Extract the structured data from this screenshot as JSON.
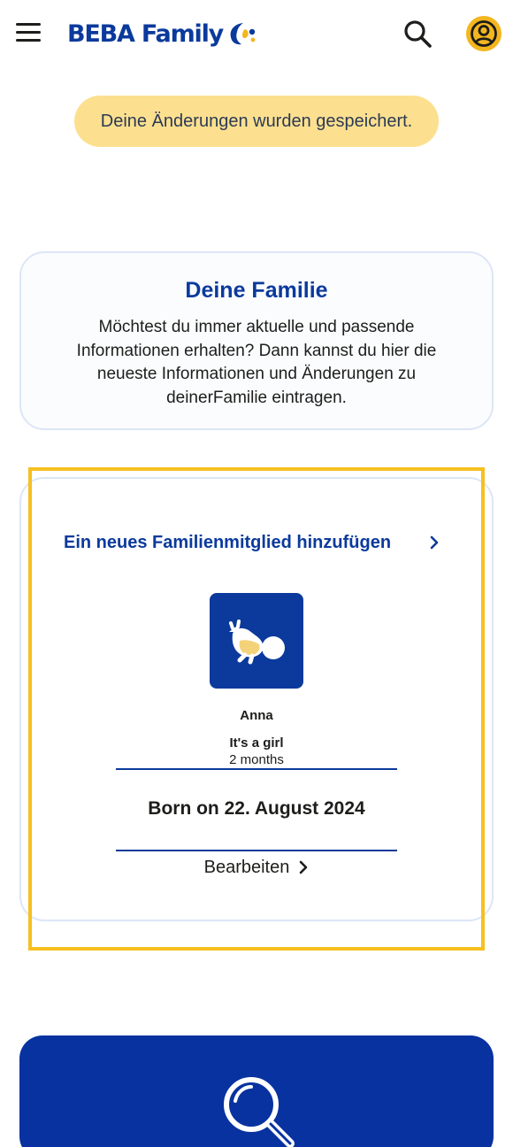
{
  "header": {
    "brand_name": "BEBA Family",
    "menu_icon": "hamburger-menu-icon",
    "search_icon": "search-icon",
    "account_icon": "user-account-icon"
  },
  "toast": {
    "message": "Deine Änderungen wurden gespeichert."
  },
  "family_info": {
    "title": "Deine Familie",
    "description": "Möchtest du immer aktuelle und passende Informationen erhalten? Dann kannst du hier die neueste Informationen und Änderungen zu deinerFamilie eintragen."
  },
  "member_card": {
    "add_member_label": "Ein neues Familienmitglied hinzufügen",
    "member": {
      "name": "Anna",
      "gender_label": "It's a girl",
      "age": "2 months",
      "birth_date": "Born on 22. August 2024",
      "avatar_icon": "baby-icon"
    },
    "edit_label": "Bearbeiten"
  },
  "search_card": {
    "icon": "magnifier-icon"
  },
  "colors": {
    "brand_blue": "#0b3a9c",
    "accent_yellow": "#f3b61f",
    "toast_yellow": "#fde08f",
    "card_border": "#dce6f7",
    "search_card_blue": "#0732a0"
  }
}
